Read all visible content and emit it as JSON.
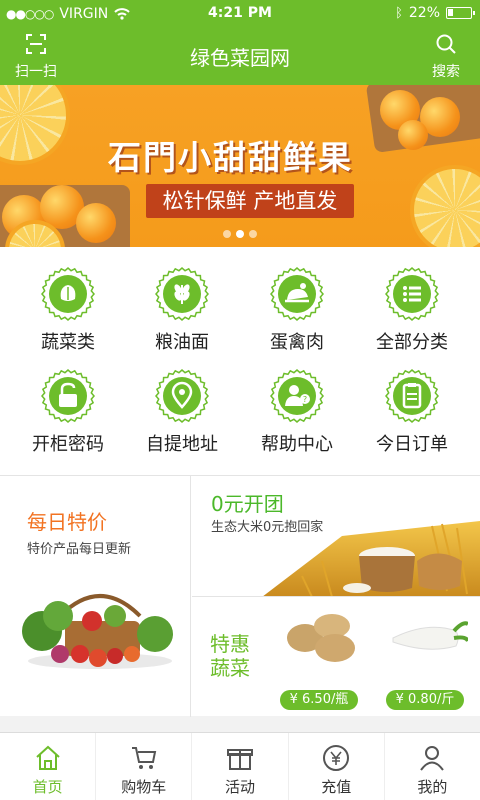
{
  "status": {
    "carrier": "VIRGIN",
    "time": "4:21 PM",
    "battery": "22%"
  },
  "header": {
    "title": "绿色菜园网",
    "scan_label": "扫一扫",
    "search_label": "搜索"
  },
  "banner": {
    "title": "石門小甜甜鲜果",
    "tagline": "松针保鲜 产地直发",
    "active_dot": 1,
    "dot_count": 3
  },
  "categories": [
    {
      "label": "蔬菜类",
      "icon": "vegetable-icon"
    },
    {
      "label": "粮油面",
      "icon": "grain-icon"
    },
    {
      "label": "蛋禽肉",
      "icon": "poultry-icon"
    },
    {
      "label": "全部分类",
      "icon": "list-icon"
    },
    {
      "label": "开柜密码",
      "icon": "unlock-icon"
    },
    {
      "label": "自提地址",
      "icon": "map-pin-icon"
    },
    {
      "label": "帮助中心",
      "icon": "help-person-icon"
    },
    {
      "label": "今日订单",
      "icon": "clipboard-icon"
    }
  ],
  "promo": {
    "daily": {
      "title": "每日特价",
      "subtitle": "特价产品每日更新"
    },
    "group": {
      "title": "0元开团",
      "subtitle": "生态大米0元抱回家"
    },
    "veg": {
      "title": "特惠蔬菜",
      "prices": [
        "¥ 6.50/瓶",
        "¥ 0.80/斤"
      ]
    }
  },
  "nav": [
    {
      "label": "首页",
      "icon": "home-icon",
      "active": true
    },
    {
      "label": "购物车",
      "icon": "cart-icon",
      "active": false
    },
    {
      "label": "活动",
      "icon": "gift-icon",
      "active": false
    },
    {
      "label": "充值",
      "icon": "yuan-icon",
      "active": false
    },
    {
      "label": "我的",
      "icon": "user-icon",
      "active": false
    }
  ],
  "colors": {
    "brand": "#6dbd2b",
    "accent": "#f27322",
    "banner": "#f59b1b"
  }
}
